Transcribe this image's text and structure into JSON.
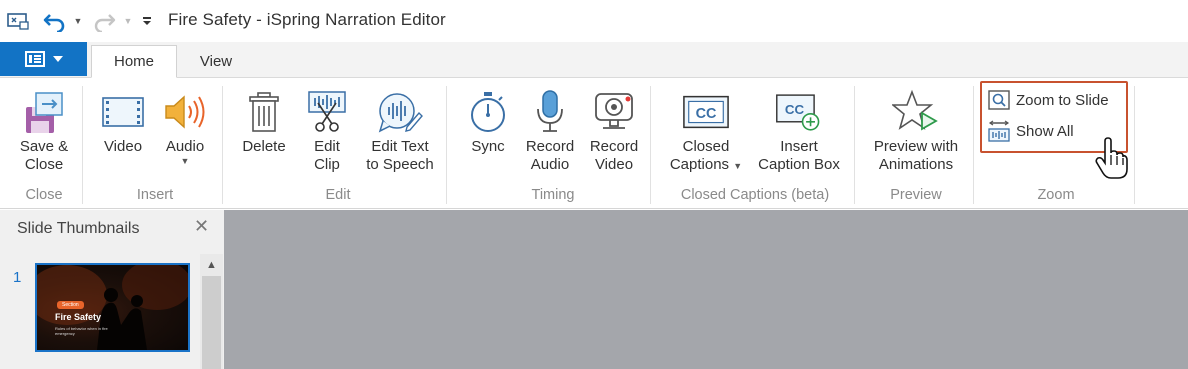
{
  "window": {
    "title": "Fire Safety - iSpring Narration Editor"
  },
  "quick_access": {
    "icons": [
      "app-icon",
      "undo-icon",
      "redo-icon",
      "customize-icon"
    ]
  },
  "tabs": [
    {
      "label": "Home",
      "active": true
    },
    {
      "label": "View",
      "active": false
    }
  ],
  "ribbon": {
    "groups": [
      {
        "label": "Close",
        "buttons": [
          {
            "label": "Save &\nClose",
            "icon": "save-close-icon"
          }
        ]
      },
      {
        "label": "Insert",
        "buttons": [
          {
            "label": "Video",
            "icon": "video-icon"
          },
          {
            "label": "Audio",
            "icon": "audio-icon",
            "has_dropdown": true
          }
        ]
      },
      {
        "label": "Edit",
        "buttons": [
          {
            "label": "Delete",
            "icon": "trash-icon"
          },
          {
            "label": "Edit\nClip",
            "icon": "edit-clip-icon"
          },
          {
            "label": "Edit Text\nto Speech",
            "icon": "text-to-speech-icon"
          }
        ]
      },
      {
        "label": "Timing",
        "buttons": [
          {
            "label": "Sync",
            "icon": "stopwatch-icon"
          },
          {
            "label": "Record\nAudio",
            "icon": "microphone-icon"
          },
          {
            "label": "Record\nVideo",
            "icon": "webcam-icon"
          }
        ]
      },
      {
        "label": "Closed Captions (beta)",
        "buttons": [
          {
            "label": "Closed\nCaptions",
            "icon": "cc-icon",
            "has_dropdown": true
          },
          {
            "label": "Insert\nCaption Box",
            "icon": "cc-add-icon"
          }
        ]
      },
      {
        "label": "Preview",
        "buttons": [
          {
            "label": "Preview with\nAnimations",
            "icon": "star-play-icon"
          }
        ]
      },
      {
        "label": "Zoom",
        "buttons": [
          {
            "label": "Zoom to Slide",
            "icon": "zoom-slide-icon"
          },
          {
            "label": "Show All",
            "icon": "show-all-icon"
          }
        ]
      }
    ]
  },
  "slide_panel": {
    "title": "Slide Thumbnails",
    "thumbnails": [
      {
        "number": "1",
        "badge": "Section",
        "heading": "Fire Safety",
        "subtext": "Rules of behavior when in fire emergency"
      }
    ]
  },
  "colors": {
    "accent": "#1273c5",
    "highlight_border": "#c8522f",
    "canvas_bg": "#a4a6ab",
    "thumb_badge": "#e8642a"
  }
}
